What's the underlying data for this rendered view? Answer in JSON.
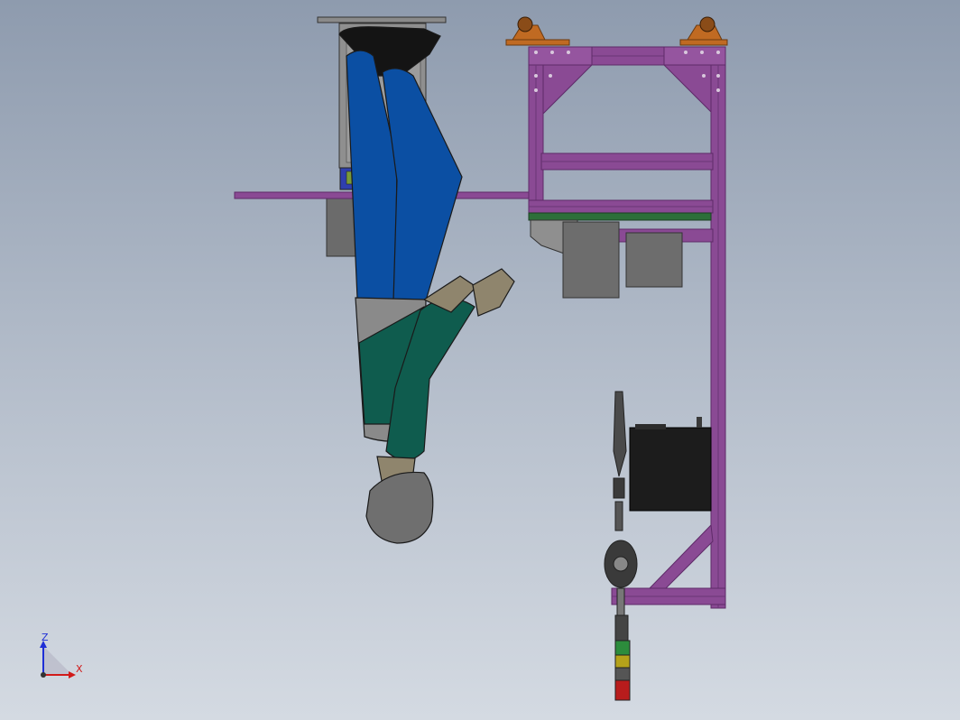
{
  "triad": {
    "z_label": "Z",
    "x_label": "X",
    "colors": {
      "z": "#1f2fd6",
      "x": "#d11a1a",
      "origin": "#333333"
    }
  },
  "colors": {
    "background_top": "#8e9bae",
    "background_bottom": "#d4dae2",
    "frame_purple": "#8a4a94",
    "frame_purple_dark": "#5e2a68",
    "pants_blue": "#0b4fa3",
    "shirt_green": "#0f5c4e",
    "skin_tan": "#8f856d",
    "head_gray": "#6f6f6f",
    "boots_black": "#141414",
    "caster_orange": "#c06a22",
    "box_gray": "#6d6d6d",
    "cabinet_black": "#1c1c1c",
    "stack_green": "#2c8c3c",
    "stack_yellow": "#b5a21a",
    "stack_red": "#b81c1c"
  }
}
